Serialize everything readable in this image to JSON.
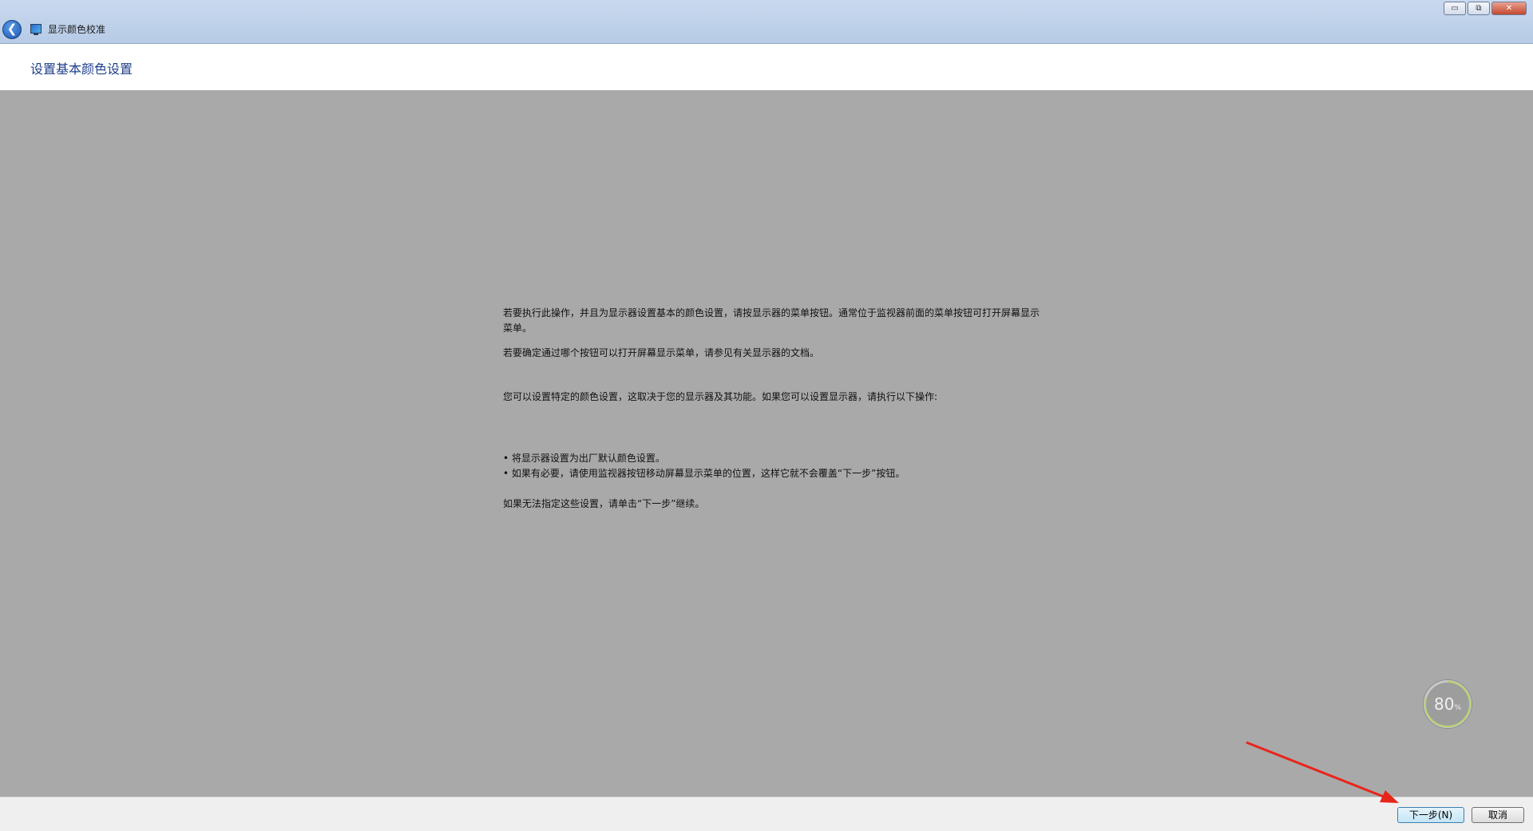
{
  "window": {
    "title": "显示颜色校准",
    "back_icon": "back-arrow-icon",
    "app_icon": "display-icon",
    "minimize_label": "▭",
    "maximize_label": "⧉",
    "close_label": "✕"
  },
  "header": {
    "title": "设置基本颜色设置"
  },
  "content": {
    "paragraph1": "若要执行此操作，并且为显示器设置基本的颜色设置，请按显示器的菜单按钮。通常位于监视器前面的菜单按钮可打开屏幕显示菜单。",
    "paragraph2": "若要确定通过哪个按钮可以打开屏幕显示菜单，请参见有关显示器的文档。",
    "paragraph3": "您可以设置特定的颜色设置，这取决于您的显示器及其功能。如果您可以设置显示器，请执行以下操作:",
    "bullets": [
      "• 将显示器设置为出厂默认颜色设置。",
      "• 如果有必要，请使用监视器按钮移动屏幕显示菜单的位置，这样它就不会覆盖“下一步”按钮。"
    ],
    "paragraph4": "如果无法指定这些设置，请单击“下一步”继续。"
  },
  "gauge": {
    "value": "80",
    "unit": "%",
    "fraction": 0.8
  },
  "footer": {
    "next_label": "下一步(N)",
    "cancel_label": "取消"
  },
  "colors": {
    "background": "#a9a9a9",
    "title_blue": "#1e3f8c",
    "annotation_arrow": "#e8251b"
  }
}
